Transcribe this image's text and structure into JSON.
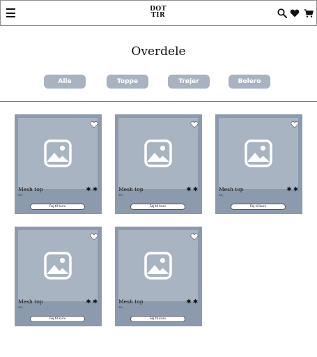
{
  "header": {
    "logo_line1": "DOT",
    "logo_line2": "TIR"
  },
  "page": {
    "title": "Overdele"
  },
  "filters": [
    {
      "label": "Alle"
    },
    {
      "label": "Toppe"
    },
    {
      "label": "Trøjer"
    },
    {
      "label": "Bolero"
    }
  ],
  "products": [
    {
      "name": "Mesh top",
      "price": "50,-",
      "cart_label": "Føj til kurv"
    },
    {
      "name": "Mesh top",
      "price": "50,-",
      "cart_label": "Føj til kurv"
    },
    {
      "name": "Mesh top",
      "price": "50,-",
      "cart_label": "Føj til kurv"
    },
    {
      "name": "Mesh top",
      "price": "50,-",
      "cart_label": "Føj til kurv"
    },
    {
      "name": "Mesh top",
      "price": "50,-",
      "cart_label": "Føj til kurv"
    }
  ],
  "icons": {
    "menu": "hamburger-menu-icon",
    "search": "search-icon",
    "wishlist": "heart-icon",
    "cart": "shopping-cart-icon",
    "product_image": "image-placeholder-icon",
    "favorite": "heart-outline-icon",
    "stars": "star-icon"
  },
  "colors": {
    "card_background": "#8c9aae",
    "image_placeholder": "#a9b4c3",
    "filter_button": "#a8b2c0"
  }
}
